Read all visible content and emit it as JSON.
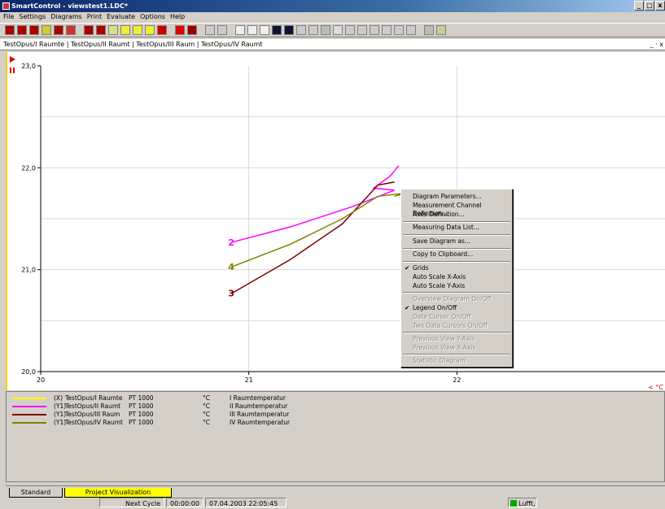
{
  "window": {
    "title": "SmartControl - viewstest1.LDC*",
    "btn_min": "_",
    "btn_max": "□",
    "btn_close": "x"
  },
  "menu": [
    "File",
    "Settings",
    "Diagrams",
    "Print",
    "Evaluate",
    "Options",
    "Help"
  ],
  "document": {
    "title": "TestOpus/I Raumte | TestOpus/II Raumt | TestOpus/III Raum | TestOpus/IV Raumt",
    "controls": "_ · x"
  },
  "chart_data": {
    "type": "line",
    "x_ticks": [
      "20",
      "21",
      "22"
    ],
    "y_ticks": [
      "23,0",
      "22,0",
      "21,0",
      "20,0"
    ],
    "xlim": [
      20,
      23
    ],
    "ylim": [
      20,
      23
    ],
    "x_unit": "< °C",
    "grid": true,
    "series": [
      {
        "name": "II Raumtemperatur",
        "color": "#ff00ff",
        "points": [
          [
            20.92,
            21.27
          ],
          [
            21.2,
            21.42
          ],
          [
            21.5,
            21.62
          ],
          [
            21.7,
            21.78
          ],
          [
            21.6,
            21.8
          ],
          [
            21.68,
            21.92
          ],
          [
            21.72,
            22.02
          ]
        ],
        "mark": "2"
      },
      {
        "name": "III Raumtemperatur",
        "color": "#800000",
        "points": [
          [
            20.92,
            20.77
          ],
          [
            21.2,
            21.1
          ],
          [
            21.45,
            21.45
          ],
          [
            21.62,
            21.83
          ],
          [
            21.7,
            21.86
          ],
          [
            21.67,
            21.85
          ]
        ],
        "mark": "3"
      },
      {
        "name": "IV Raumtemperatur",
        "color": "#808000",
        "points": [
          [
            20.92,
            21.03
          ],
          [
            21.2,
            21.25
          ],
          [
            21.45,
            21.5
          ],
          [
            21.62,
            21.72
          ],
          [
            21.75,
            21.75
          ],
          [
            21.7,
            21.72
          ]
        ],
        "mark": "4"
      }
    ]
  },
  "legend": [
    {
      "color": "#ffff00",
      "axis": "(X)",
      "channel": "TestOpus/I Raumte",
      "sensor": "PT 1000",
      "unit": "°C",
      "name": "I Raumtemperatur"
    },
    {
      "color": "#ff00ff",
      "axis": "(Y1)",
      "channel": "TestOpus/II Raumt",
      "sensor": "PT 1000",
      "unit": "°C",
      "name": "II Raumtemperatur"
    },
    {
      "color": "#800000",
      "axis": "(Y1)",
      "channel": "TestOpus/III Raum",
      "sensor": "PT 1000",
      "unit": "°C",
      "name": "III Raumtemperatur"
    },
    {
      "color": "#808000",
      "axis": "(Y1)",
      "channel": "TestOpus/IV Raumt",
      "sensor": "PT 1000",
      "unit": "°C",
      "name": "IV Raumtemperatur"
    }
  ],
  "context_menu": {
    "diagram_parameters": "Diagram Parameters...",
    "measurement_channel": "Measurement Channel Definition...",
    "axes_definition": "Axes Definition...",
    "measuring_data_list": "Measuring Data List...",
    "save_diagram": "Save Diagram as...",
    "copy_clipboard": "Copy to Clipboard...",
    "grids": "Grids",
    "auto_x": "Auto Scale X-Axis",
    "auto_y": "Auto Scale Y-Axis",
    "overview": "Overview Diagram On/Off",
    "legend": "Legend On/Off",
    "date_cursor": "Date Cursor On/Off",
    "two_cursors": "Two Data Cursors On/Off",
    "prev_y": "Previous View Y-Axis",
    "prev_x": "Previous View X-Axis",
    "statistic": "Statistic Diagram",
    "check": "✔"
  },
  "tabs": {
    "standard": "Standard",
    "project": "Project Visualization"
  },
  "status": {
    "next_cycle": "Next Cycle",
    "timer": "00:00:00",
    "datetime": "07.04.2003 22:05:45",
    "indicator": "Lufft,"
  }
}
